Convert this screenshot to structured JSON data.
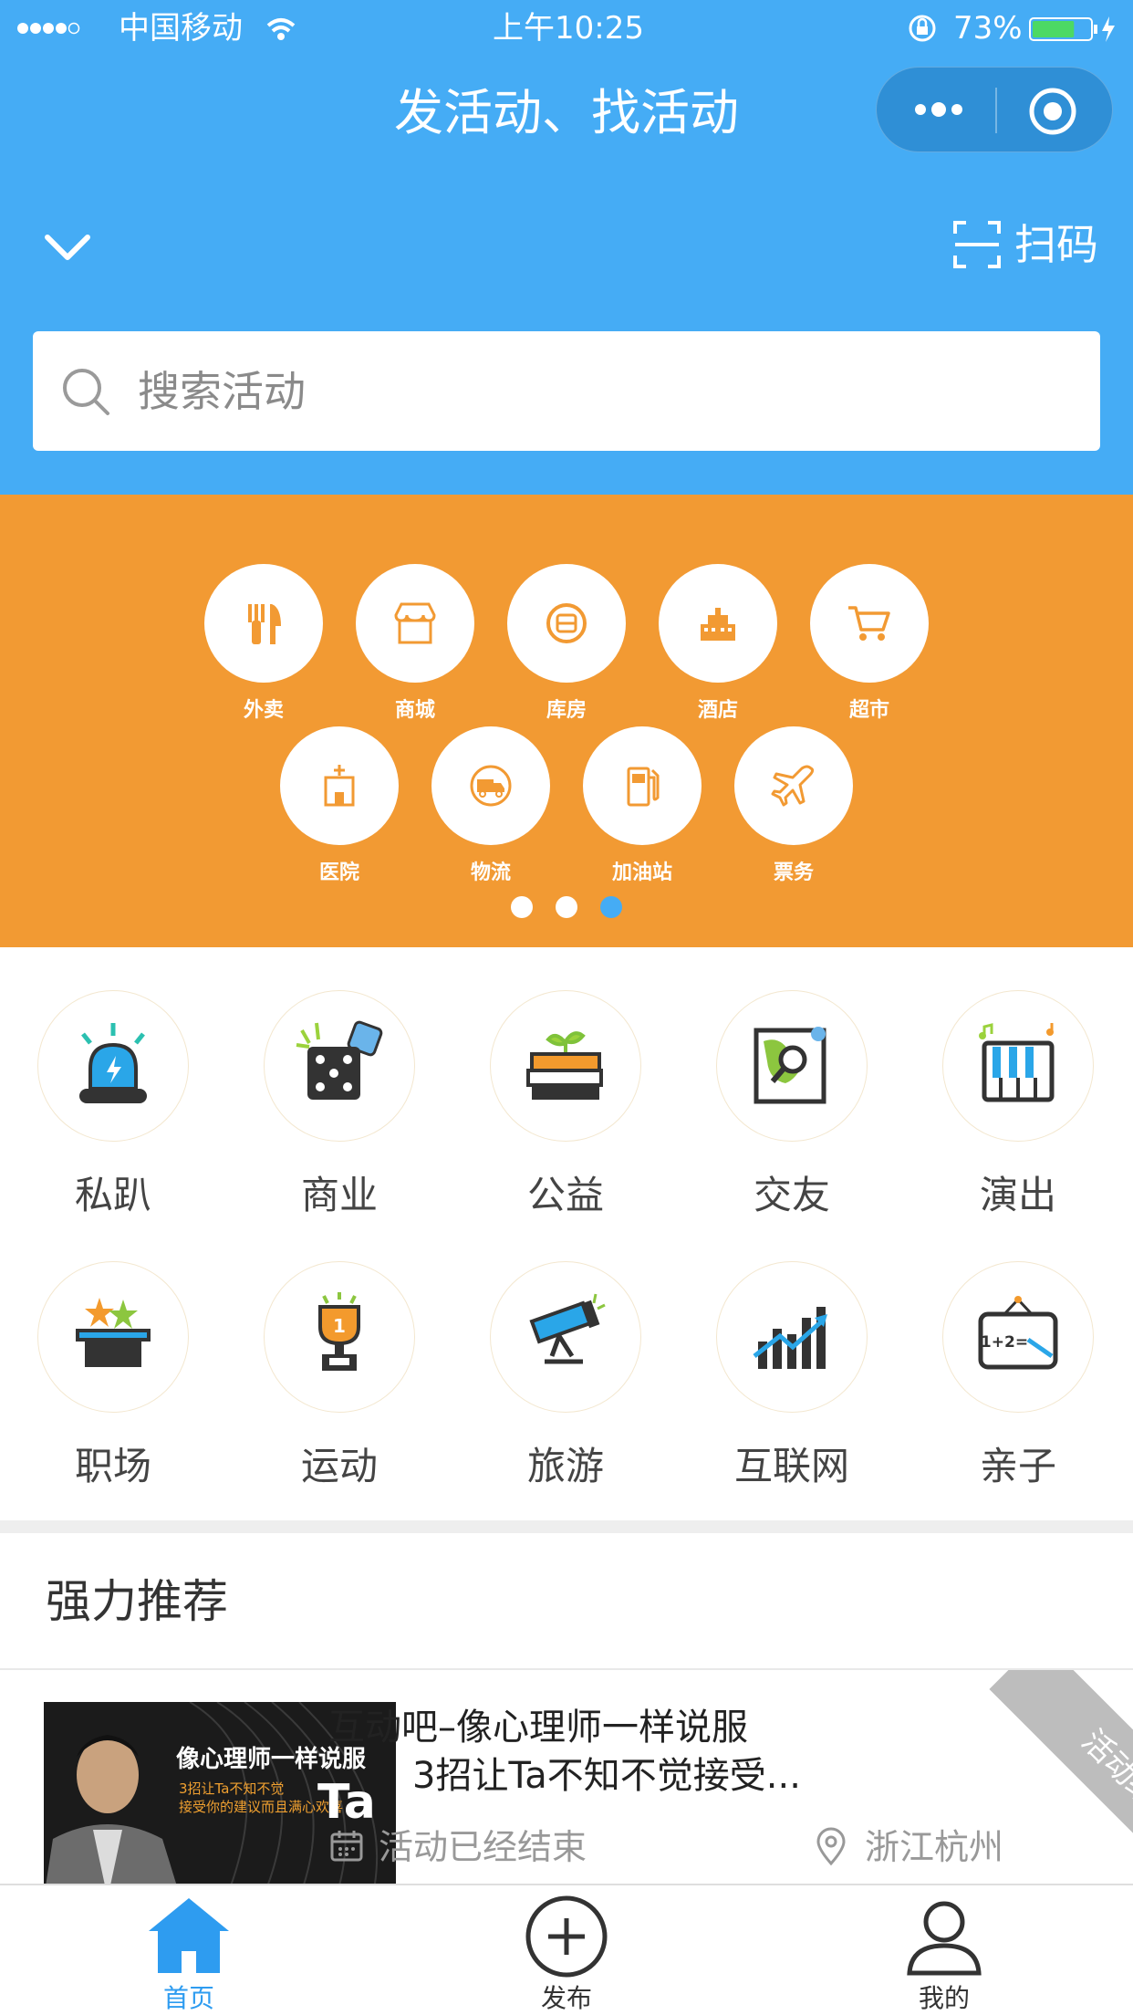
{
  "status_bar": {
    "carrier": "中国移动",
    "time": "上午10:25",
    "battery": "73%",
    "battery_level": 0.73
  },
  "header": {
    "title": "发活动、找活动",
    "scan_label": "扫码"
  },
  "search": {
    "placeholder": "搜索活动"
  },
  "banner": {
    "row1": [
      "外卖",
      "商城",
      "库房",
      "酒店",
      "超市"
    ],
    "row2": [
      "医院",
      "物流",
      "加油站",
      "票务"
    ],
    "page_count": 3,
    "active_page": 3
  },
  "categories": {
    "row1": [
      "私趴",
      "商业",
      "公益",
      "交友",
      "演出"
    ],
    "row2": [
      "职场",
      "运动",
      "旅游",
      "互联网",
      "亲子"
    ]
  },
  "recommend": {
    "section_title": "强力推荐",
    "card": {
      "title_line1": "互动吧–像心理师一样说服",
      "title_line2": "3招让Ta不知不觉接受...",
      "status": "活动已经结束",
      "location": "浙江杭州",
      "ribbon": "活动结束",
      "thumb_title": "像心理师一样说服",
      "thumb_big": "Ta",
      "thumb_sub1": "3招让Ta不知不觉",
      "thumb_sub2": "接受你的建议而且满心欢喜"
    }
  },
  "tabbar": {
    "items": [
      {
        "label": "首页"
      },
      {
        "label": "发布"
      },
      {
        "label": "我的"
      }
    ]
  },
  "colors": {
    "header_blue": "#45acf5",
    "banner_orange": "#f29a33",
    "active_tab": "#2e9cf0"
  }
}
